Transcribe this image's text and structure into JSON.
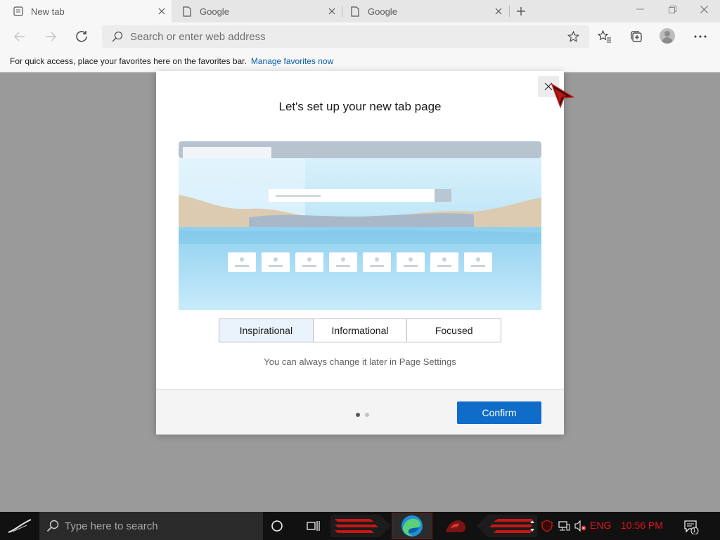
{
  "browser": {
    "tabs": [
      {
        "title": "New tab",
        "icon": "new-tab-page-icon",
        "active": true
      },
      {
        "title": "Google",
        "icon": "page-icon",
        "active": false
      },
      {
        "title": "Google",
        "icon": "page-icon",
        "active": false
      }
    ],
    "address_placeholder": "Search or enter web address",
    "favorites_bar": {
      "message": "For quick access, place your favorites here on the favorites bar.",
      "link": "Manage favorites now"
    }
  },
  "dialog": {
    "title": "Let's set up your new tab page",
    "options": [
      "Inspirational",
      "Informational",
      "Focused"
    ],
    "selected_option": "Inspirational",
    "hint": "You can always change it later in Page Settings",
    "confirm_label": "Confirm",
    "pager": {
      "total": 2,
      "current": 1
    }
  },
  "taskbar": {
    "search_placeholder": "Type here to search",
    "language": "ENG",
    "clock": "10:56 PM",
    "notification_count": "1"
  },
  "colors": {
    "accent": "#0f6cc9",
    "link": "#0b5ea8",
    "tray_text": "#e4141c",
    "taskbar_bg": "#111111",
    "page_overlay": "#9a9a9a"
  }
}
